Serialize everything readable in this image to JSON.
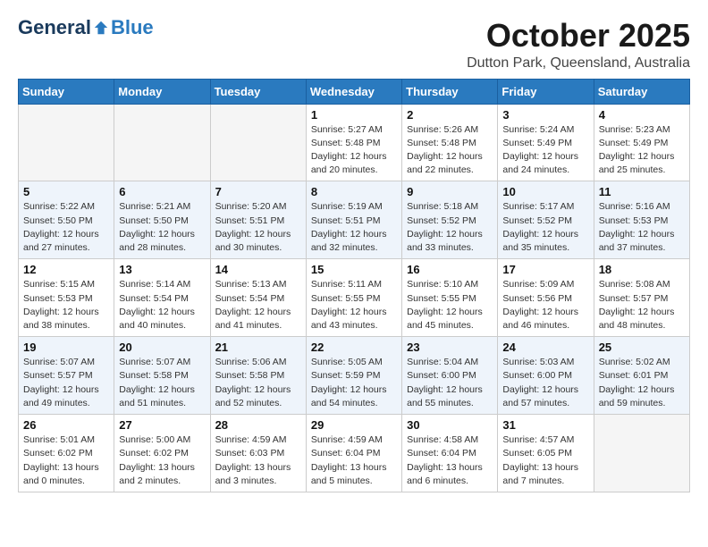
{
  "header": {
    "logo_general": "General",
    "logo_blue": "Blue",
    "month": "October 2025",
    "location": "Dutton Park, Queensland, Australia"
  },
  "weekdays": [
    "Sunday",
    "Monday",
    "Tuesday",
    "Wednesday",
    "Thursday",
    "Friday",
    "Saturday"
  ],
  "weeks": [
    [
      {
        "day": "",
        "sunrise": "",
        "sunset": "",
        "daylight": "",
        "empty": true
      },
      {
        "day": "",
        "sunrise": "",
        "sunset": "",
        "daylight": "",
        "empty": true
      },
      {
        "day": "",
        "sunrise": "",
        "sunset": "",
        "daylight": "",
        "empty": true
      },
      {
        "day": "1",
        "sunrise": "Sunrise: 5:27 AM",
        "sunset": "Sunset: 5:48 PM",
        "daylight": "Daylight: 12 hours and 20 minutes."
      },
      {
        "day": "2",
        "sunrise": "Sunrise: 5:26 AM",
        "sunset": "Sunset: 5:48 PM",
        "daylight": "Daylight: 12 hours and 22 minutes."
      },
      {
        "day": "3",
        "sunrise": "Sunrise: 5:24 AM",
        "sunset": "Sunset: 5:49 PM",
        "daylight": "Daylight: 12 hours and 24 minutes."
      },
      {
        "day": "4",
        "sunrise": "Sunrise: 5:23 AM",
        "sunset": "Sunset: 5:49 PM",
        "daylight": "Daylight: 12 hours and 25 minutes."
      }
    ],
    [
      {
        "day": "5",
        "sunrise": "Sunrise: 5:22 AM",
        "sunset": "Sunset: 5:50 PM",
        "daylight": "Daylight: 12 hours and 27 minutes."
      },
      {
        "day": "6",
        "sunrise": "Sunrise: 5:21 AM",
        "sunset": "Sunset: 5:50 PM",
        "daylight": "Daylight: 12 hours and 28 minutes."
      },
      {
        "day": "7",
        "sunrise": "Sunrise: 5:20 AM",
        "sunset": "Sunset: 5:51 PM",
        "daylight": "Daylight: 12 hours and 30 minutes."
      },
      {
        "day": "8",
        "sunrise": "Sunrise: 5:19 AM",
        "sunset": "Sunset: 5:51 PM",
        "daylight": "Daylight: 12 hours and 32 minutes."
      },
      {
        "day": "9",
        "sunrise": "Sunrise: 5:18 AM",
        "sunset": "Sunset: 5:52 PM",
        "daylight": "Daylight: 12 hours and 33 minutes."
      },
      {
        "day": "10",
        "sunrise": "Sunrise: 5:17 AM",
        "sunset": "Sunset: 5:52 PM",
        "daylight": "Daylight: 12 hours and 35 minutes."
      },
      {
        "day": "11",
        "sunrise": "Sunrise: 5:16 AM",
        "sunset": "Sunset: 5:53 PM",
        "daylight": "Daylight: 12 hours and 37 minutes."
      }
    ],
    [
      {
        "day": "12",
        "sunrise": "Sunrise: 5:15 AM",
        "sunset": "Sunset: 5:53 PM",
        "daylight": "Daylight: 12 hours and 38 minutes."
      },
      {
        "day": "13",
        "sunrise": "Sunrise: 5:14 AM",
        "sunset": "Sunset: 5:54 PM",
        "daylight": "Daylight: 12 hours and 40 minutes."
      },
      {
        "day": "14",
        "sunrise": "Sunrise: 5:13 AM",
        "sunset": "Sunset: 5:54 PM",
        "daylight": "Daylight: 12 hours and 41 minutes."
      },
      {
        "day": "15",
        "sunrise": "Sunrise: 5:11 AM",
        "sunset": "Sunset: 5:55 PM",
        "daylight": "Daylight: 12 hours and 43 minutes."
      },
      {
        "day": "16",
        "sunrise": "Sunrise: 5:10 AM",
        "sunset": "Sunset: 5:55 PM",
        "daylight": "Daylight: 12 hours and 45 minutes."
      },
      {
        "day": "17",
        "sunrise": "Sunrise: 5:09 AM",
        "sunset": "Sunset: 5:56 PM",
        "daylight": "Daylight: 12 hours and 46 minutes."
      },
      {
        "day": "18",
        "sunrise": "Sunrise: 5:08 AM",
        "sunset": "Sunset: 5:57 PM",
        "daylight": "Daylight: 12 hours and 48 minutes."
      }
    ],
    [
      {
        "day": "19",
        "sunrise": "Sunrise: 5:07 AM",
        "sunset": "Sunset: 5:57 PM",
        "daylight": "Daylight: 12 hours and 49 minutes."
      },
      {
        "day": "20",
        "sunrise": "Sunrise: 5:07 AM",
        "sunset": "Sunset: 5:58 PM",
        "daylight": "Daylight: 12 hours and 51 minutes."
      },
      {
        "day": "21",
        "sunrise": "Sunrise: 5:06 AM",
        "sunset": "Sunset: 5:58 PM",
        "daylight": "Daylight: 12 hours and 52 minutes."
      },
      {
        "day": "22",
        "sunrise": "Sunrise: 5:05 AM",
        "sunset": "Sunset: 5:59 PM",
        "daylight": "Daylight: 12 hours and 54 minutes."
      },
      {
        "day": "23",
        "sunrise": "Sunrise: 5:04 AM",
        "sunset": "Sunset: 6:00 PM",
        "daylight": "Daylight: 12 hours and 55 minutes."
      },
      {
        "day": "24",
        "sunrise": "Sunrise: 5:03 AM",
        "sunset": "Sunset: 6:00 PM",
        "daylight": "Daylight: 12 hours and 57 minutes."
      },
      {
        "day": "25",
        "sunrise": "Sunrise: 5:02 AM",
        "sunset": "Sunset: 6:01 PM",
        "daylight": "Daylight: 12 hours and 59 minutes."
      }
    ],
    [
      {
        "day": "26",
        "sunrise": "Sunrise: 5:01 AM",
        "sunset": "Sunset: 6:02 PM",
        "daylight": "Daylight: 13 hours and 0 minutes."
      },
      {
        "day": "27",
        "sunrise": "Sunrise: 5:00 AM",
        "sunset": "Sunset: 6:02 PM",
        "daylight": "Daylight: 13 hours and 2 minutes."
      },
      {
        "day": "28",
        "sunrise": "Sunrise: 4:59 AM",
        "sunset": "Sunset: 6:03 PM",
        "daylight": "Daylight: 13 hours and 3 minutes."
      },
      {
        "day": "29",
        "sunrise": "Sunrise: 4:59 AM",
        "sunset": "Sunset: 6:04 PM",
        "daylight": "Daylight: 13 hours and 5 minutes."
      },
      {
        "day": "30",
        "sunrise": "Sunrise: 4:58 AM",
        "sunset": "Sunset: 6:04 PM",
        "daylight": "Daylight: 13 hours and 6 minutes."
      },
      {
        "day": "31",
        "sunrise": "Sunrise: 4:57 AM",
        "sunset": "Sunset: 6:05 PM",
        "daylight": "Daylight: 13 hours and 7 minutes."
      },
      {
        "day": "",
        "sunrise": "",
        "sunset": "",
        "daylight": "",
        "empty": true
      }
    ]
  ]
}
